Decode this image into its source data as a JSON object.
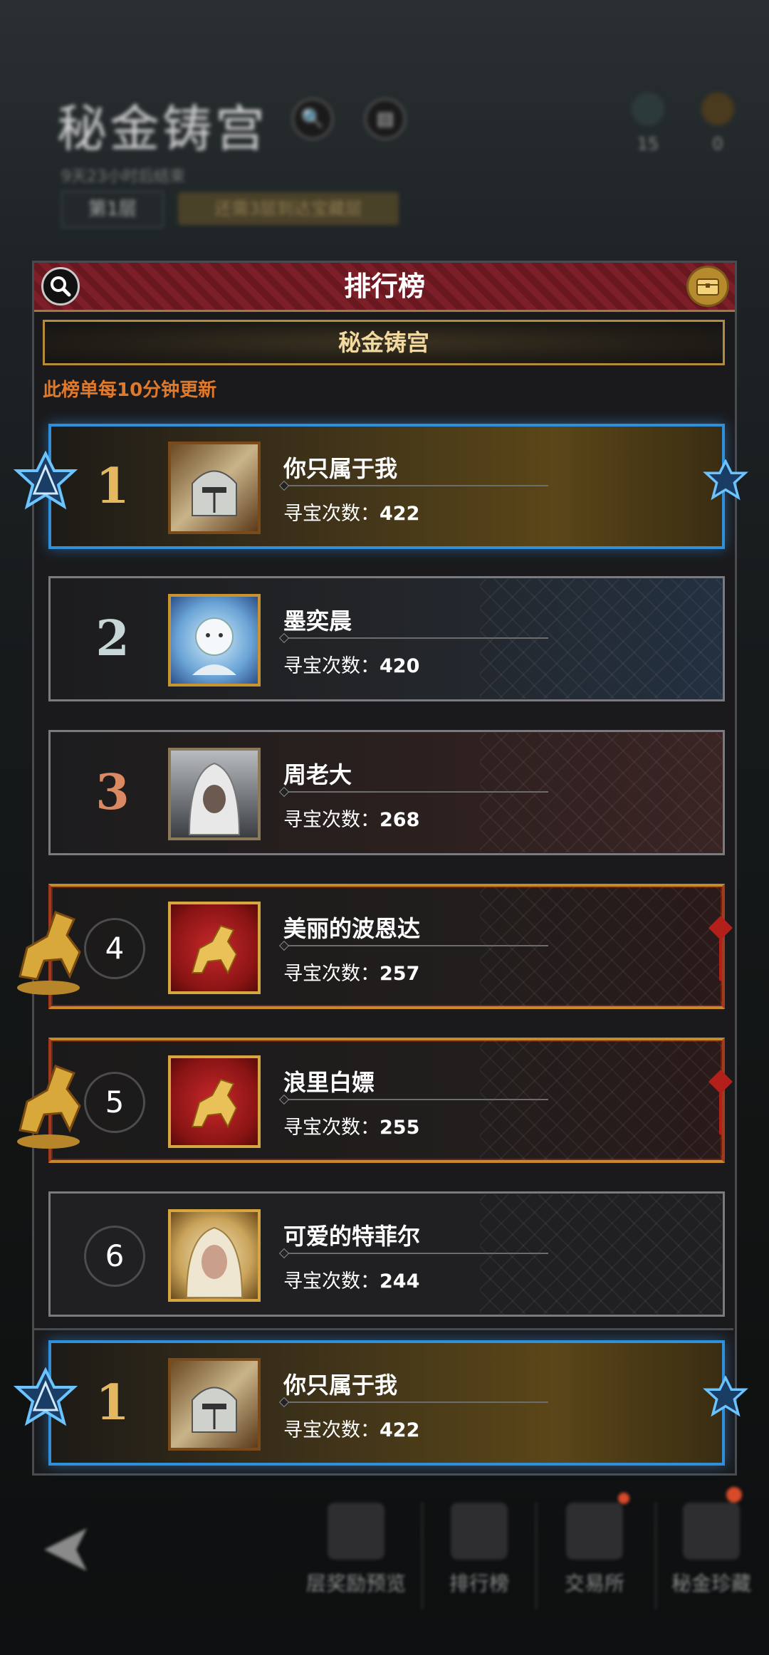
{
  "background": {
    "title": "秘金铸宫",
    "subtitle": "9天23小时后结束",
    "floor_label": "第1层",
    "hint": "还需3层到达宝藏层",
    "resources": [
      {
        "icon": "feather-icon",
        "value": "15"
      },
      {
        "icon": "compass-icon",
        "value": "0"
      }
    ]
  },
  "panel": {
    "title": "排行榜",
    "tab_label": "秘金铸宫",
    "update_note": "此榜单每10分钟更新"
  },
  "ranking": [
    {
      "rank": "1",
      "name": "你只属于我",
      "count_label": "寻宝次数：",
      "count": "422",
      "style": "gold"
    },
    {
      "rank": "2",
      "name": "墨奕晨",
      "count_label": "寻宝次数：",
      "count": "420",
      "style": "silver"
    },
    {
      "rank": "3",
      "name": "周老大",
      "count_label": "寻宝次数：",
      "count": "268",
      "style": "bronze"
    },
    {
      "rank": "4",
      "name": "美丽的波恩达",
      "count_label": "寻宝次数：",
      "count": "257",
      "style": "horse"
    },
    {
      "rank": "5",
      "name": "浪里白嫖",
      "count_label": "寻宝次数：",
      "count": "255",
      "style": "horse"
    },
    {
      "rank": "6",
      "name": "可爱的特菲尔",
      "count_label": "寻宝次数：",
      "count": "244",
      "style": "plain"
    }
  ],
  "own_entry": {
    "rank": "1",
    "name": "你只属于我",
    "count_label": "寻宝次数：",
    "count": "422"
  },
  "bottom_nav": [
    {
      "label": "层奖励预览",
      "icon": "reward-preview-icon"
    },
    {
      "label": "排行榜",
      "icon": "trophy-icon"
    },
    {
      "label": "交易所",
      "icon": "exchange-icon"
    },
    {
      "label": "秘金珍藏",
      "icon": "treasure-icon"
    }
  ],
  "colors": {
    "accent_gold": "#e4b860",
    "update_note": "#e07a2a",
    "rank1_border": "#2f8fd8",
    "header_red": "#7c1f28"
  }
}
